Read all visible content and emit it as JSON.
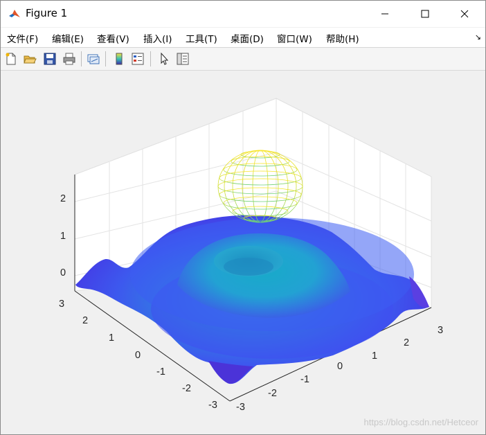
{
  "window": {
    "title": "Figure 1"
  },
  "menu": [
    {
      "label": "文件(F)"
    },
    {
      "label": "编辑(E)"
    },
    {
      "label": "查看(V)"
    },
    {
      "label": "插入(I)"
    },
    {
      "label": "工具(T)"
    },
    {
      "label": "桌面(D)"
    },
    {
      "label": "窗口(W)"
    },
    {
      "label": "帮助(H)"
    }
  ],
  "toolbar": [
    "new-figure-icon",
    "open-file-icon",
    "save-icon",
    "print-icon",
    "link-plot-icon",
    "colorbar-icon",
    "legend-icon",
    "pointer-icon",
    "property-editor-icon"
  ],
  "chart_data": {
    "type": "surface",
    "axes": {
      "x_ticks": [
        "-3",
        "-2",
        "-1",
        "0",
        "1",
        "2",
        "3"
      ],
      "y_ticks": [
        "-3",
        "-2",
        "-1",
        "0",
        "1",
        "2",
        "3"
      ],
      "z_ticks": [
        "0",
        "1",
        "2"
      ],
      "xlim": [
        -3,
        3
      ],
      "ylim": [
        -3,
        3
      ],
      "zlim": [
        -0.3,
        2.7
      ],
      "grid": true
    },
    "surfaces": [
      {
        "kind": "radial ripple surface (filled, parula colormap)",
        "z_range": [
          -0.4,
          1.1
        ]
      },
      {
        "kind": "sphere wireframe mesh",
        "color": "yellow-green",
        "z_range": [
          1.6,
          2.4
        ]
      }
    ]
  },
  "watermark": "https://blog.csdn.net/Hetceor"
}
